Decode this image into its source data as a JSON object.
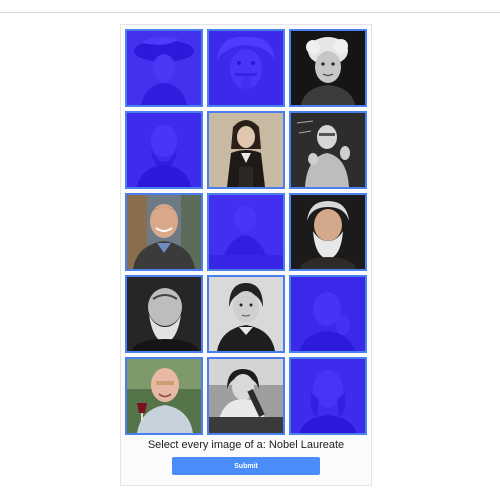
{
  "captcha": {
    "prompt_prefix": "Select every image of a:",
    "target": "Nobel Laureate",
    "submit_label": "Submit",
    "selection_color": "#2a14ff",
    "tiles": [
      {
        "subject": "woman-in-feathered-hat",
        "photo": "bw",
        "selected": true
      },
      {
        "subject": "man-sticking-out-tongue",
        "photo": "bw",
        "selected": true
      },
      {
        "subject": "woman-with-curled-hair",
        "photo": "bw",
        "selected": false
      },
      {
        "subject": "bearded-man-with-pince-nez",
        "photo": "bw",
        "selected": true
      },
      {
        "subject": "long-haired-man-in-coat",
        "photo": "color",
        "selected": false
      },
      {
        "subject": "man-gesturing-at-blackboard",
        "photo": "bw",
        "selected": false
      },
      {
        "subject": "smiling-man-in-bookshelf-room",
        "photo": "color",
        "selected": false
      },
      {
        "subject": "man-at-desk",
        "photo": "bw",
        "selected": true
      },
      {
        "subject": "white-bearded-man",
        "photo": "color",
        "selected": false
      },
      {
        "subject": "old-man-with-beard",
        "photo": "bw",
        "selected": false
      },
      {
        "subject": "woman-in-dark-sweater",
        "photo": "bw",
        "selected": false
      },
      {
        "subject": "man-with-hand-on-head",
        "photo": "bw",
        "selected": true
      },
      {
        "subject": "man-holding-wine-glass",
        "photo": "color",
        "selected": false
      },
      {
        "subject": "woman-with-microscope",
        "photo": "bw",
        "selected": false
      },
      {
        "subject": "man-with-side-whiskers",
        "photo": "bw",
        "selected": true
      }
    ]
  }
}
